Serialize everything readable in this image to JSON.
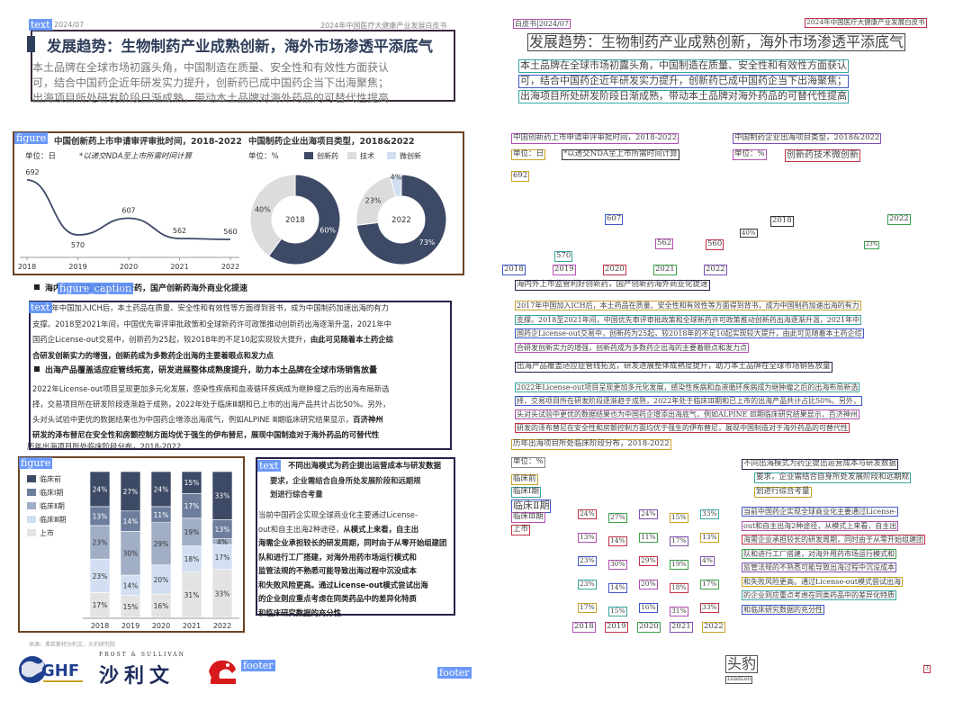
{
  "header": {
    "date": "2024/07",
    "report_title": "2024年中国医疗大健康产业发展白皮书"
  },
  "headline": {
    "title": "发展趋势：生物制药产业成熟创新，海外市场渗透平添底气",
    "intro_lines": [
      "本土品牌在全球市场初露头角，中国制造在质量、安全性和有效性方面获认",
      "可，结合中国药企近年研发实力提升，创新药已成中国药企当下出海聚焦；",
      "出海项目所处研发阶段日渐成熟，带动本土品牌对海外药品的可替代性提高"
    ]
  },
  "tags": {
    "text": "text",
    "figure": "figure",
    "figure_caption": "figure_caption",
    "footer": "footer"
  },
  "chart1": {
    "title": "中国创新药上市申请审评审批时间，2018-2022",
    "unit": "单位：日",
    "note": "*以递交NDA至上市所需时间计算"
  },
  "chart2": {
    "title": "中国制药企业出海项目类型，2018&2022",
    "unit": "单位：%",
    "legend": [
      "创新药",
      "技术",
      "微创新"
    ]
  },
  "chart3": {
    "unit": "单位：%",
    "legend": [
      "临床前",
      "临床Ⅰ期",
      "临床Ⅱ期",
      "临床Ⅲ期",
      "上市"
    ]
  },
  "chart_data": [
    {
      "type": "line",
      "title": "中国创新药上市申请审评审批时间，2018-2022",
      "ylabel": "单位：日",
      "x": [
        "2018",
        "2019",
        "2020",
        "2021",
        "2022"
      ],
      "values": [
        692,
        570,
        607,
        562,
        560
      ],
      "ylim": [
        540,
        700
      ],
      "grid": false
    },
    {
      "type": "pie",
      "title": "中国制药企业出海项目类型，2018&2022",
      "ylabel": "单位：%",
      "series": [
        {
          "name": "2018",
          "categories": [
            "创新药",
            "技术",
            "微创新"
          ],
          "values": [
            60,
            40,
            0
          ],
          "labels": [
            "60%",
            "40%",
            ""
          ]
        },
        {
          "name": "2022",
          "categories": [
            "创新药",
            "技术",
            "微创新"
          ],
          "values": [
            73,
            23,
            4
          ],
          "labels": [
            "73%",
            "23%",
            "4%"
          ]
        }
      ],
      "colors": [
        "#3d4a66",
        "#dcdcdc",
        "#d2dff2"
      ],
      "legend": "top"
    },
    {
      "type": "bar",
      "stacked": true,
      "ylabel": "单位：%",
      "categories": [
        "2018",
        "2019",
        "2020",
        "2021",
        "2022"
      ],
      "series": [
        {
          "name": "上市",
          "values": [
            17,
            15,
            16,
            31,
            33
          ],
          "color": "#e3e3e3"
        },
        {
          "name": "临床Ⅲ期",
          "values": [
            23,
            14,
            20,
            18,
            17
          ],
          "color": "#d2dff2"
        },
        {
          "name": "临床Ⅱ期",
          "values": [
            23,
            30,
            29,
            19,
            4
          ],
          "color": "#a0aec6"
        },
        {
          "name": "临床Ⅰ期",
          "values": [
            13,
            14,
            11,
            17,
            13
          ],
          "color": "#6d7d9c"
        },
        {
          "name": "临床前",
          "values": [
            24,
            27,
            24,
            15,
            33
          ],
          "color": "#3d4a66"
        }
      ],
      "ylim": [
        0,
        100
      ],
      "legend": "left"
    }
  ],
  "sections": {
    "s1_title": "海内外上市监管利好创新药，国产创新药海外商业化提速",
    "s1_lines": [
      {
        "plain": "2017年中国加入ICH后，本土药品在质量、安全性和有效性等方面得到背书，成为中国制药加速出海的有力",
        "bold": ""
      },
      {
        "plain": "支撑。2018至2021年间，中国优先审评审批政策和全球新药许可政策推动创新药出海逐渐升温，2021年中",
        "bold": ""
      },
      {
        "plain": "国药企License-out交易中，创新药为25起，较2018年的不足10起实现较大提升，",
        "bold": "由此可见随着本土药企综"
      },
      {
        "plain": "",
        "bold": "合研发创新实力的增强，创新药成为多数药企出海的主要着眼点和发力点"
      }
    ],
    "s2_title": "出海产品覆盖适应症管线拓宽，研发进展整体成熟度提升，助力本土品牌在全球市场销售放量",
    "s2_lines": [
      {
        "plain": "2022年License-out项目呈现更加多元化发展，感染性疾病和血液循环疾病成为继肿瘤之后的出海布局新选",
        "bold": ""
      },
      {
        "plain": "择，交易项目所在研发阶段逐渐趋于成熟，2022年处于临床Ⅲ期和已上市的出海产品共计占比50%。另外，",
        "bold": ""
      },
      {
        "plain": "头对头试验中更优的数据结果也为中国药企增添出海底气，例如ALPINE Ⅲ期临床研究结果显示，",
        "bold": "百济神州"
      },
      {
        "plain": "",
        "bold": "研发的泽布替尼在安全性和房颤控制方面均优于强生的伊布替尼，展现中国制造对于海外药品的可替代性"
      }
    ],
    "chart3_title": "历年出海项目所处临床阶段分布，2018-2022",
    "s3_title": "不同出海模式为药企提出运营成本与研发数据",
    "s3_title_lines": [
      "要求，企业需结合自身所处发展阶段和远期规",
      "划进行综合考量"
    ],
    "s3_lines": [
      {
        "plain": "当前中国药企实现全球商业化主要通过License-",
        "bold": ""
      },
      {
        "plain": "out和自主出海2种途径，",
        "bold": "从模式上来看，自主出"
      },
      {
        "plain": "",
        "bold": "海需企业承担较长的研发周期，同时由于从零开始组建团"
      },
      {
        "plain": "",
        "bold": "队和进行工厂搭建，对海外用药市场运行模式和"
      },
      {
        "plain": "",
        "bold": "监管法规的不熟悉可能导致出海过程中沉没成本"
      },
      {
        "plain": "",
        "bold": "和失败风险更高。通过License-out模式尝试出海"
      },
      {
        "plain": "",
        "bold": "的企业则应重点考虑在同类药品中的差异化特质"
      },
      {
        "plain": "",
        "bold": "和临床研究数据的充分性"
      }
    ]
  },
  "footer": {
    "source": "来源：弗若斯特沙利文，头豹研究院",
    "ghf_text": "GHF",
    "fs_en": "FROST & SULLIVAN",
    "fs_cn": "沙利文",
    "lx_text": "头豹",
    "lx_sub": "LeadLeo",
    "page_no": "3"
  }
}
